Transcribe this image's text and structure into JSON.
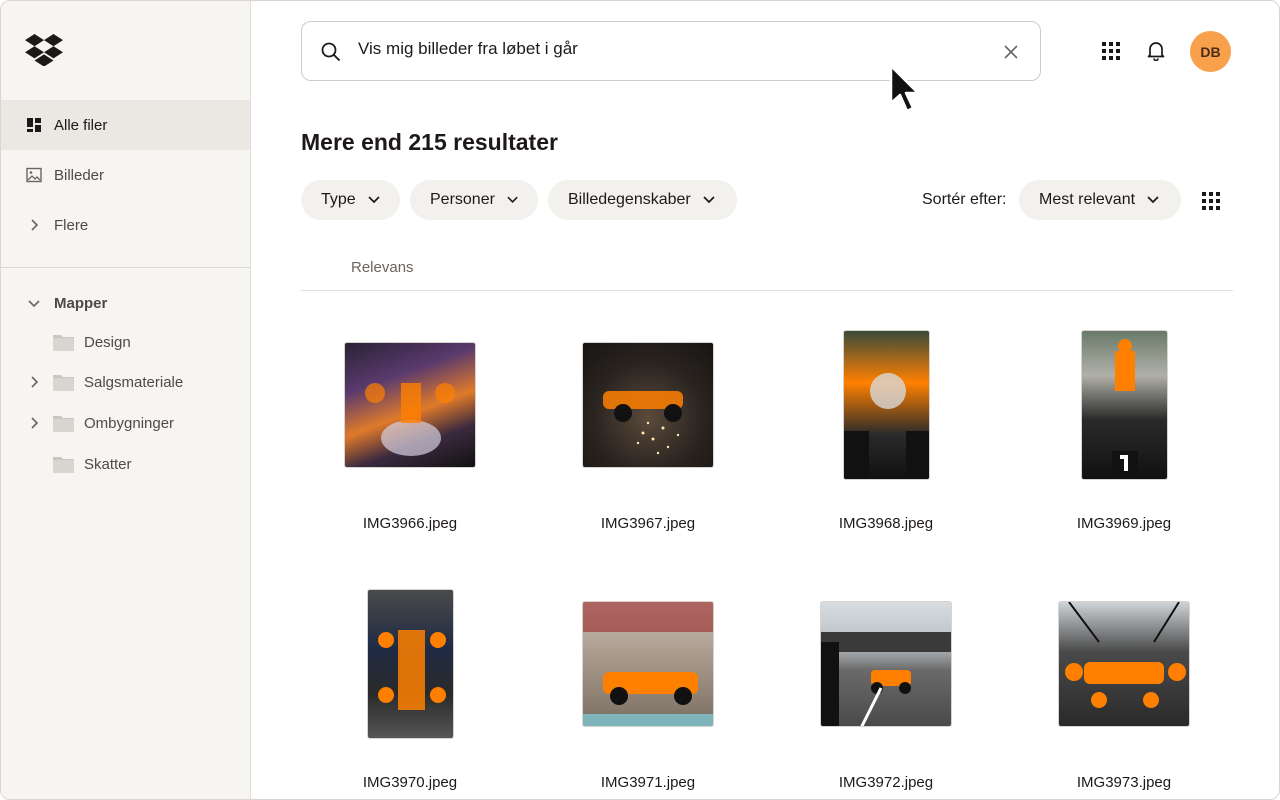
{
  "sidebar": {
    "nav": [
      {
        "label": "Alle filer",
        "icon": "all-files-icon",
        "active": true
      },
      {
        "label": "Billeder",
        "icon": "image-icon",
        "active": false
      },
      {
        "label": "Flere",
        "icon": "chevron-right-icon",
        "active": false
      }
    ],
    "folders_heading": "Mapper",
    "folders": [
      {
        "label": "Design",
        "expandable": false
      },
      {
        "label": "Salgsmateriale",
        "expandable": true
      },
      {
        "label": "Ombygninger",
        "expandable": true
      },
      {
        "label": "Skatter",
        "expandable": false
      }
    ]
  },
  "search": {
    "query": "Vis mig billeder fra løbet i går"
  },
  "header": {
    "avatar_initials": "DB"
  },
  "results": {
    "title": "Mere end 215 resultater",
    "filters": [
      "Type",
      "Personer",
      "Billedegenskaber"
    ],
    "sort_label": "Sortér efter:",
    "sort_value": "Mest relevant",
    "column_header": "Relevans",
    "files": [
      {
        "name": "IMG3966.jpeg",
        "orientation": "landscape"
      },
      {
        "name": "IMG3967.jpeg",
        "orientation": "landscape"
      },
      {
        "name": "IMG3968.jpeg",
        "orientation": "portrait"
      },
      {
        "name": "IMG3969.jpeg",
        "orientation": "portrait"
      },
      {
        "name": "IMG3970.jpeg",
        "orientation": "portrait"
      },
      {
        "name": "IMG3971.jpeg",
        "orientation": "landscape"
      },
      {
        "name": "IMG3972.jpeg",
        "orientation": "landscape"
      },
      {
        "name": "IMG3973.jpeg",
        "orientation": "landscape"
      }
    ]
  },
  "colors": {
    "accent": "#f8a04c",
    "sidebar_bg": "#f7f5f2",
    "chip_bg": "#f3f1ee",
    "papaya": "#ff8000"
  }
}
